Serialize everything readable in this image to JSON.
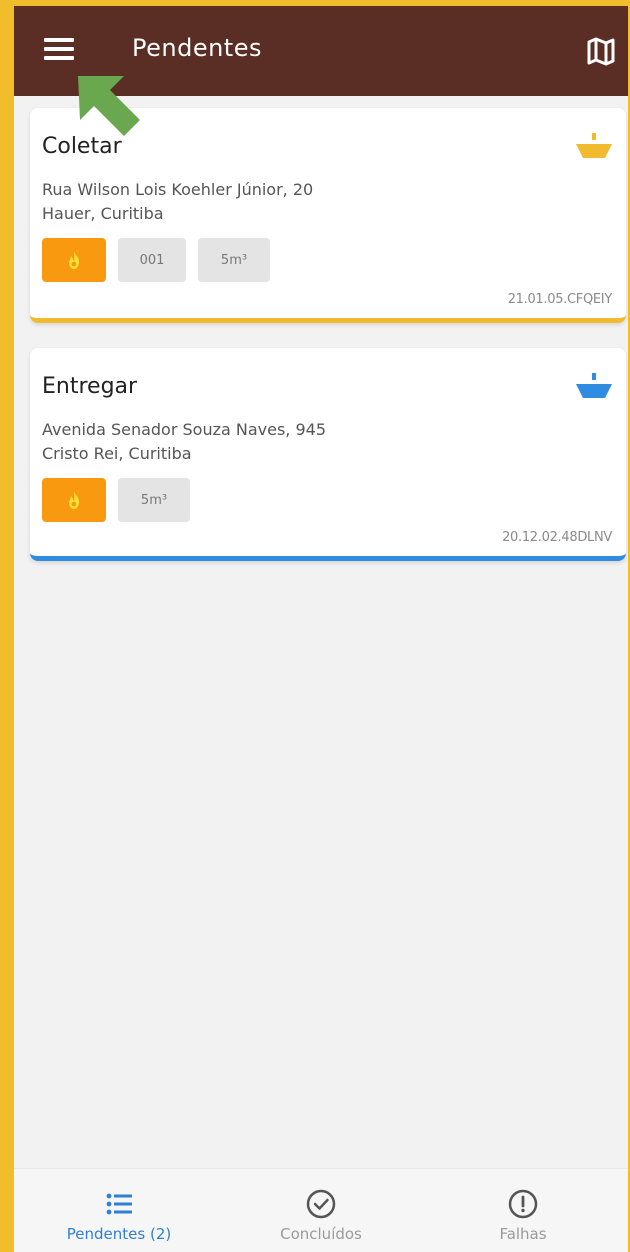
{
  "app_bar": {
    "title": "Pendentes",
    "menu_icon": "hamburger-menu-icon",
    "map_icon": "map-icon"
  },
  "cards": [
    {
      "title": "Coletar",
      "address_line1": "Rua Wilson Lois Koehler Júnior, 20",
      "address_line2": "Hauer, Curitiba",
      "chips": [
        "001",
        "5m³"
      ],
      "code": "21.01.05.CFQEIY",
      "accent": "#f0bb2f",
      "icon": "bucket-collect-icon"
    },
    {
      "title": "Entregar",
      "address_line1": "Avenida Senador Souza Naves, 945",
      "address_line2": "Cristo Rei, Curitiba",
      "chips": [
        "5m³"
      ],
      "code": "20.12.02.48DLNV",
      "accent": "#2f8ce1",
      "icon": "bucket-deliver-icon"
    }
  ],
  "bottom_nav": {
    "items": [
      {
        "label": "Pendentes (2)",
        "icon": "list-icon",
        "active": true
      },
      {
        "label": "Concluídos",
        "icon": "check-circle-icon",
        "active": false
      },
      {
        "label": "Falhas",
        "icon": "alert-circle-icon",
        "active": false
      }
    ],
    "active_color": "#2f7fd8",
    "inactive_color": "#9a9a9a"
  },
  "colors": {
    "app_bar": "#5a2d25",
    "frame": "#f2bd2b",
    "fire_chip": "#f9990f",
    "pointer_arrow": "#6aa84f"
  }
}
